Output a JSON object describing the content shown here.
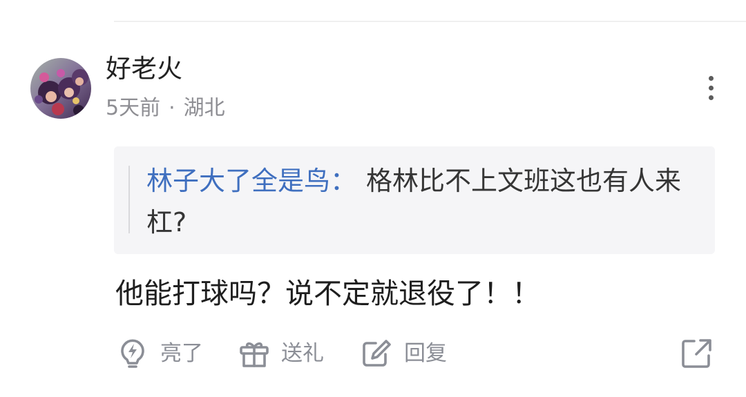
{
  "comment": {
    "user": {
      "name": "好老火"
    },
    "meta": {
      "time": "5天前",
      "separator": "·",
      "location": "湖北"
    },
    "more_icon": "more-vertical-icon",
    "quote": {
      "author": "林子大了全是鸟",
      "separator": "：",
      "text": "格林比不上文班这也有人来杠?"
    },
    "text": "他能打球吗？说不定就退役了！！",
    "actions": {
      "like": {
        "label": "亮了",
        "icon": "lightbulb-icon"
      },
      "gift": {
        "label": "送礼",
        "icon": "gift-icon"
      },
      "reply": {
        "label": "回复",
        "icon": "edit-icon"
      },
      "share": {
        "icon": "share-icon"
      }
    }
  },
  "colors": {
    "background": "#ffffff",
    "text_primary": "#1e1e1e",
    "text_secondary": "#8e8e93",
    "quote_background": "#f5f5f7",
    "quote_author": "#3f6fbf",
    "action_gray": "#8b8e96"
  }
}
